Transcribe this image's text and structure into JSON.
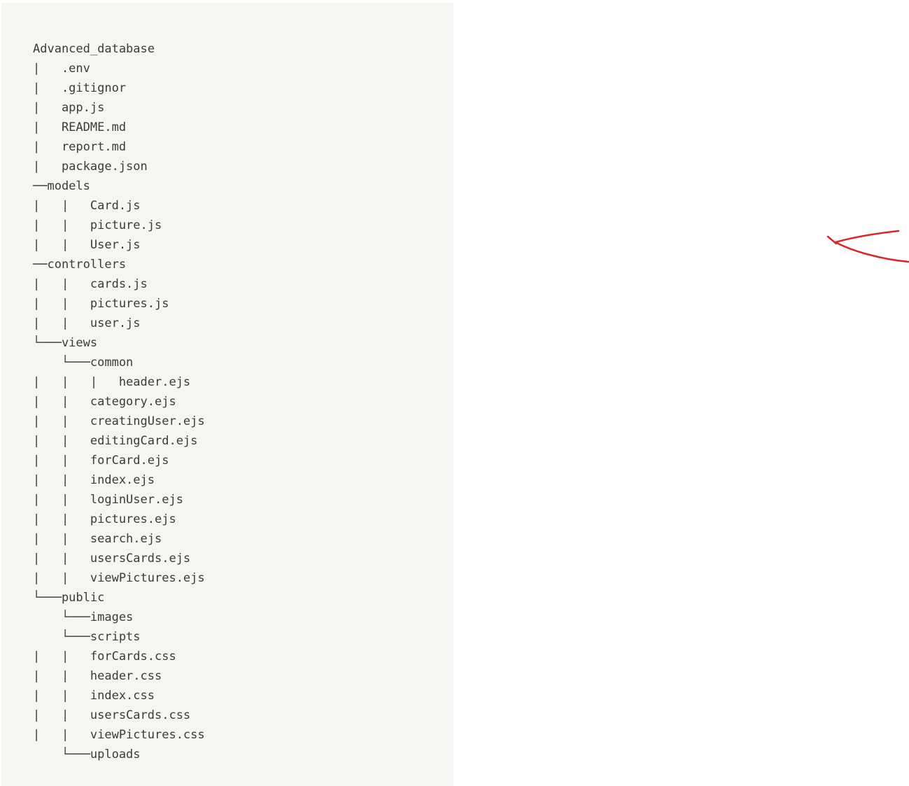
{
  "file_tree": {
    "lines": [
      "Advanced_database",
      "|   .env",
      "|   .gitignor",
      "|   app.js",
      "|   README.md",
      "|   report.md",
      "|   package.json",
      "──models",
      "|   |   Card.js",
      "|   |   picture.js",
      "|   |   User.js",
      "──controllers",
      "|   |   cards.js",
      "|   |   pictures.js",
      "|   |   user.js",
      "└───views",
      "    └───common",
      "|   |   |   header.ejs",
      "|   |   category.ejs",
      "|   |   creatingUser.ejs",
      "|   |   editingCard.ejs",
      "|   |   forCard.ejs",
      "|   |   index.ejs",
      "|   |   loginUser.ejs",
      "|   |   pictures.ejs",
      "|   |   search.ejs",
      "|   |   usersCards.ejs",
      "|   |   viewPictures.ejs",
      "└───public",
      "    └───images",
      "    └───scripts",
      "|   |   forCards.css",
      "|   |   header.css",
      "|   |   index.css",
      "|   |   usersCards.css",
      "|   |   viewPictures.css",
      "    └───uploads"
    ]
  },
  "annotation": {
    "icon": "red-hand-drawn-arrow-icon",
    "color": "#d9262b"
  }
}
